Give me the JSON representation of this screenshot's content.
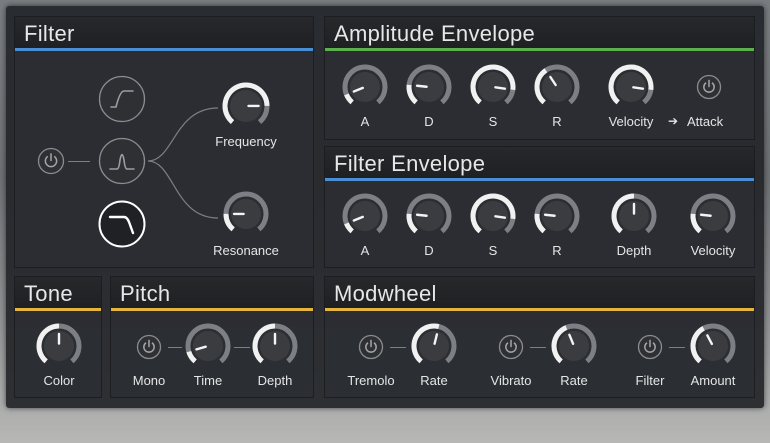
{
  "colors": {
    "blue": "#4a8fd6",
    "green": "#5bb04b",
    "yellow": "#e6b43c",
    "knob_track": "#7c7f84",
    "knob_value": "#f1f1f1"
  },
  "filter": {
    "title": "Filter",
    "modes": [
      {
        "icon": "lowpass-filter-icon",
        "selected": false
      },
      {
        "icon": "bandpass-filter-icon",
        "selected": false
      },
      {
        "icon": "highcut-filter-icon",
        "selected": true
      }
    ],
    "power_icon": "power-icon",
    "knobs": [
      {
        "label": "Frequency",
        "value": 0.82
      },
      {
        "label": "Resonance",
        "value": 0.18
      }
    ]
  },
  "amp_env": {
    "title": "Amplitude Envelope",
    "knobs": [
      {
        "label": "A",
        "value": 0.1
      },
      {
        "label": "D",
        "value": 0.2
      },
      {
        "label": "S",
        "value": 0.85
      },
      {
        "label": "R",
        "value": 0.38
      },
      {
        "label": "Velocity",
        "value": 0.85
      }
    ],
    "attack_label": "Attack",
    "attack_arrow": "➔"
  },
  "filter_env": {
    "title": "Filter Envelope",
    "knobs": [
      {
        "label": "A",
        "value": 0.1
      },
      {
        "label": "D",
        "value": 0.2
      },
      {
        "label": "S",
        "value": 0.85
      },
      {
        "label": "R",
        "value": 0.2
      },
      {
        "label": "Depth",
        "value": 0.5
      },
      {
        "label": "Velocity",
        "value": 0.2
      }
    ]
  },
  "tone": {
    "title": "Tone",
    "knobs": [
      {
        "label": "Color",
        "value": 0.5
      }
    ]
  },
  "pitch": {
    "title": "Pitch",
    "mono_label": "Mono",
    "knobs": [
      {
        "label": "Time",
        "value": 0.12
      },
      {
        "label": "Depth",
        "value": 0.5
      }
    ]
  },
  "modwheel": {
    "title": "Modwheel",
    "toggles": [
      "Tremolo",
      "Vibrato",
      "Filter"
    ],
    "knobs": [
      {
        "label": "Rate",
        "value": 0.55
      },
      {
        "label": "Rate",
        "value": 0.42
      },
      {
        "label": "Amount",
        "value": 0.4
      }
    ]
  }
}
